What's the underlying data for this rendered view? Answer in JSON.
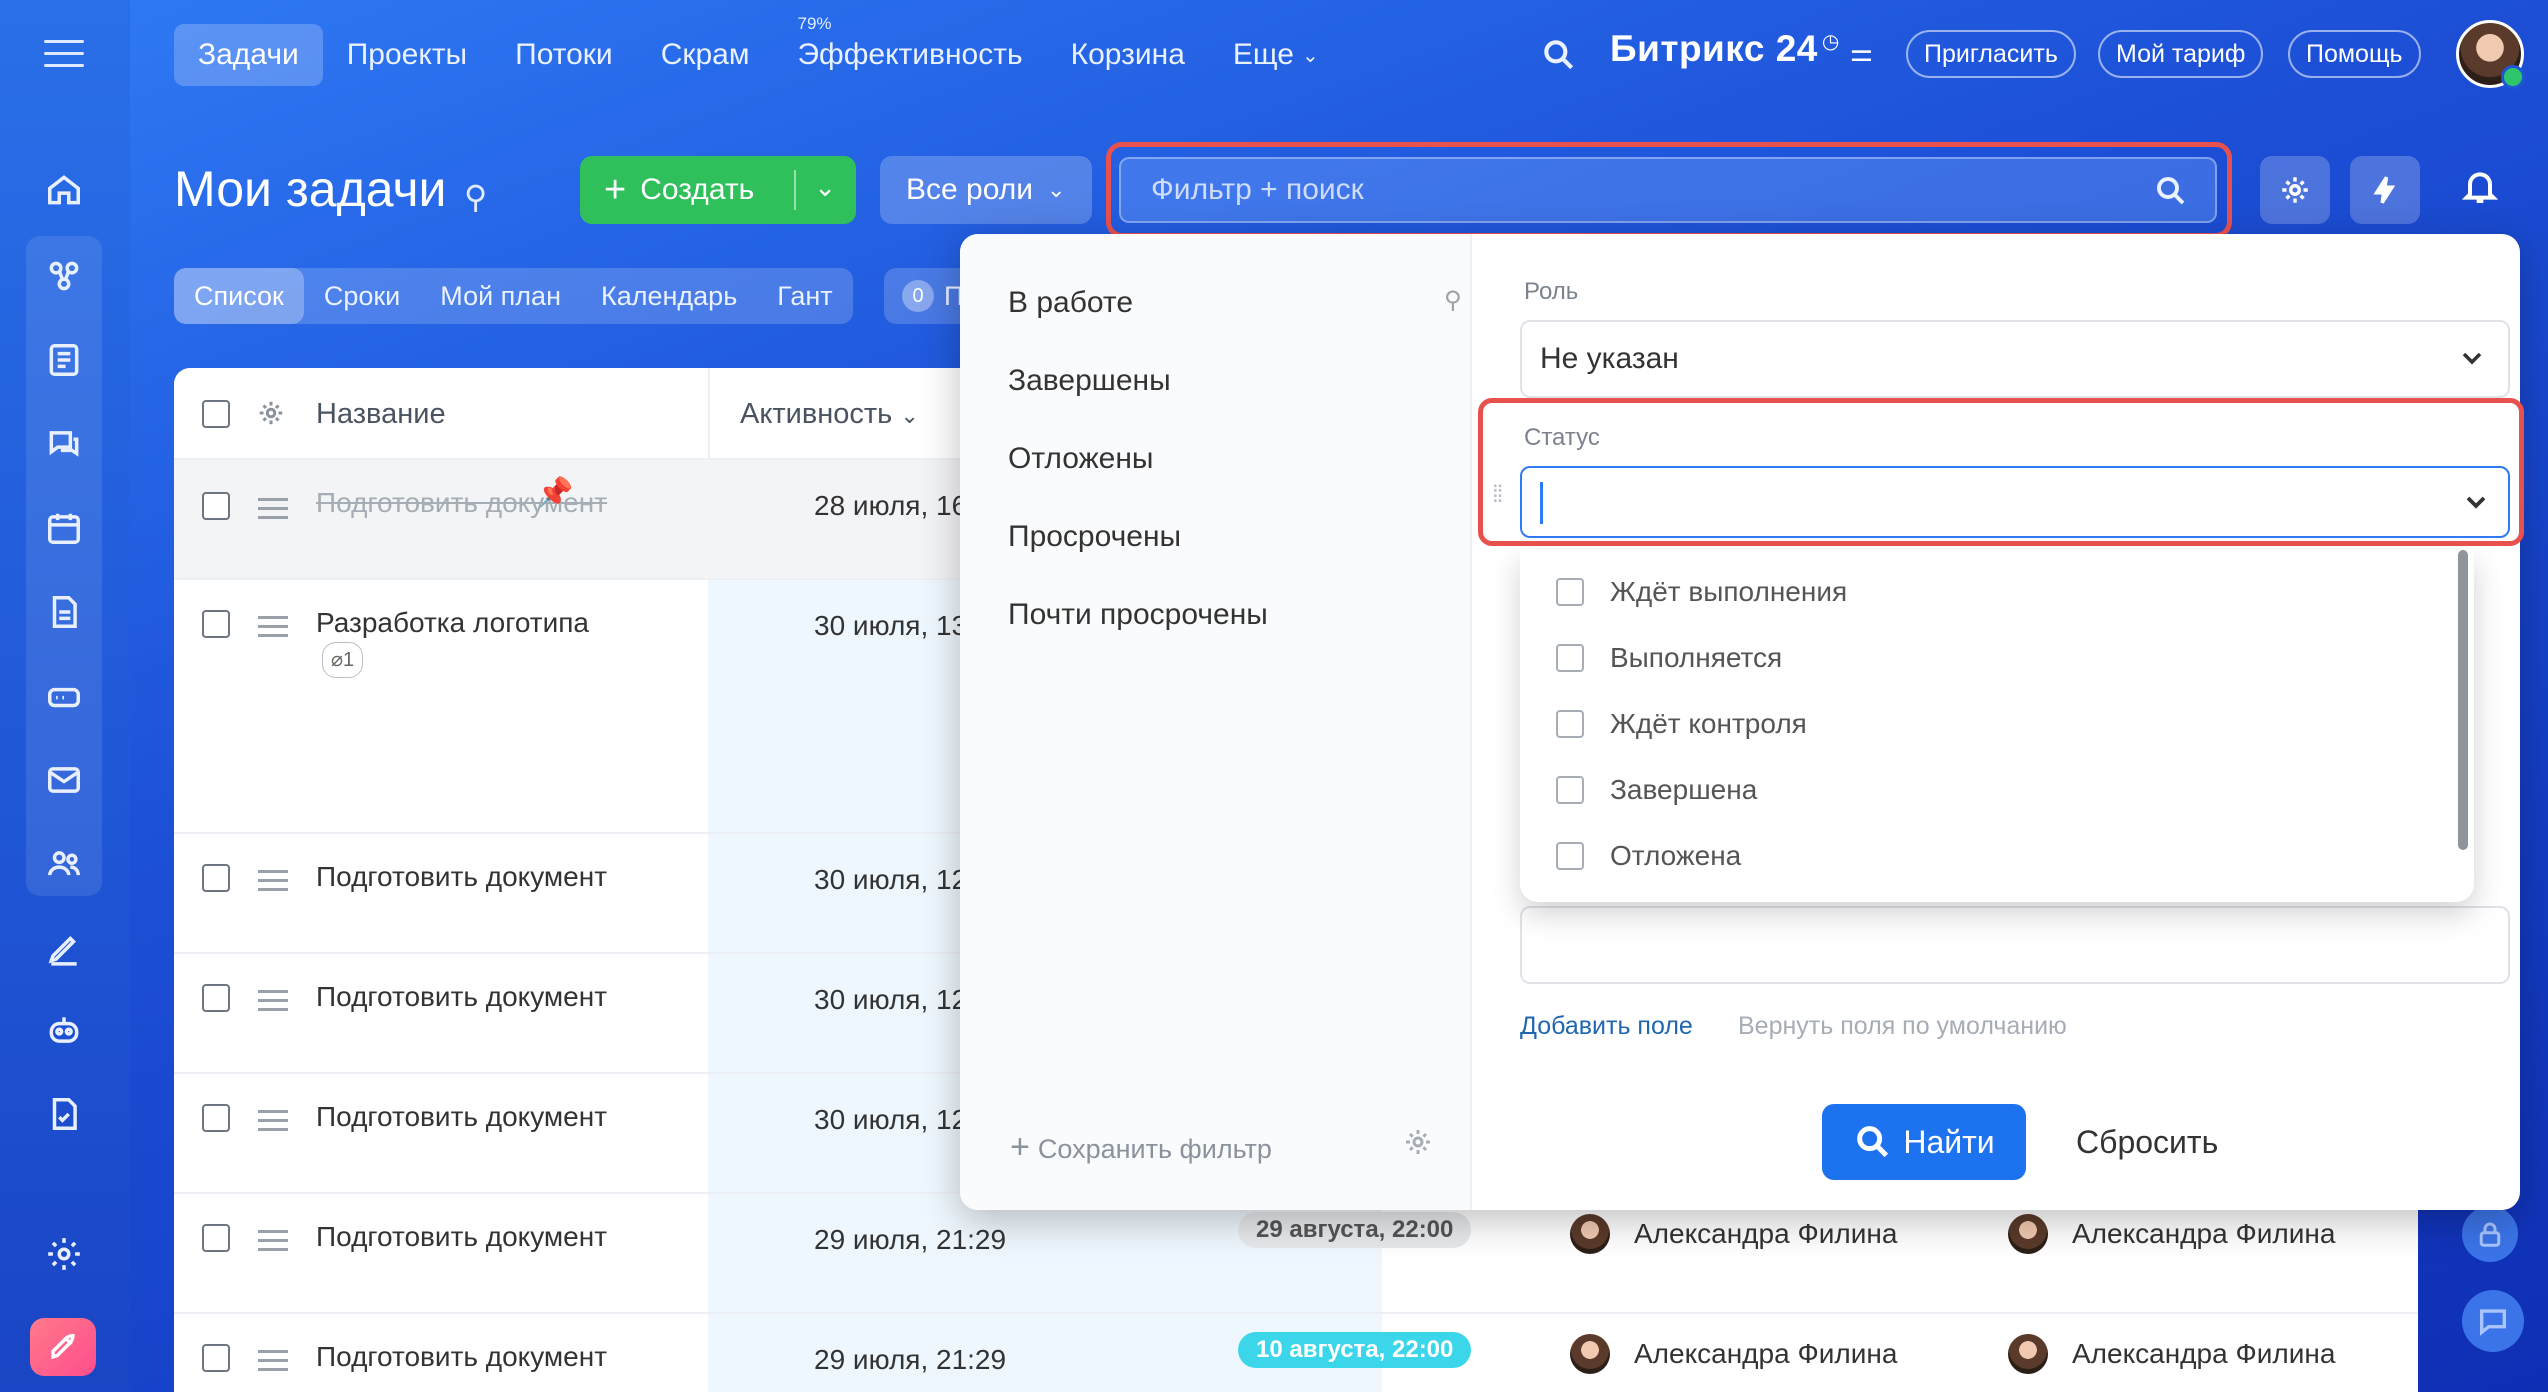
{
  "nav": {
    "items": [
      {
        "label": "Задачи",
        "active": true
      },
      {
        "label": "Проекты"
      },
      {
        "label": "Потоки"
      },
      {
        "label": "Скрам"
      },
      {
        "label": "Эффективность",
        "badge": "79%"
      },
      {
        "label": "Корзина"
      },
      {
        "label": "Еще",
        "dropdown": true
      }
    ]
  },
  "brand": {
    "name": "Битрикс 24"
  },
  "header_buttons": {
    "invite": "Пригласить",
    "tariff": "Мой тариф",
    "help": "Помощь"
  },
  "page": {
    "title": "Мои задачи",
    "create_label": "Создать",
    "roles_label": "Все роли",
    "filter_placeholder": "Фильтр + поиск"
  },
  "view_tabs": [
    "Список",
    "Сроки",
    "Мой план",
    "Календарь",
    "Гант"
  ],
  "counter": {
    "value": "0",
    "text": "П"
  },
  "table": {
    "columns": {
      "name": "Название",
      "activity": "Активность"
    },
    "rows": [
      {
        "title": "Подготовить документ",
        "date": "28 июля, 16",
        "done": true,
        "pinned": true
      },
      {
        "title": "Разработка логотипа",
        "date": "30 июля, 13",
        "attach": "1"
      },
      {
        "title": "Подготовить документ",
        "date": "30 июля, 12"
      },
      {
        "title": "Подготовить документ",
        "date": "30 июля, 12"
      },
      {
        "title": "Подготовить документ",
        "date": "30 июля, 12"
      },
      {
        "title": "Подготовить документ",
        "date": "29 июля, 21:29",
        "deadline": "29 августа, 22:00",
        "deadline_color": "gray",
        "person1": "Александра Филина",
        "person2": "Александра Филина"
      },
      {
        "title": "Подготовить документ",
        "date": "29 июля, 21:29",
        "deadline": "10 августа, 22:00",
        "deadline_color": "cyan",
        "person1": "Александра Филина",
        "person2": "Александра Филина"
      }
    ]
  },
  "filter_popup": {
    "presets": [
      "В работе",
      "Завершены",
      "Отложены",
      "Просрочены",
      "Почти просрочены"
    ],
    "save_filter": "Сохранить фильтр",
    "role_label": "Роль",
    "role_value": "Не указан",
    "status_label": "Статус",
    "status_options": [
      "Ждёт выполнения",
      "Выполняется",
      "Ждёт контроля",
      "Завершена",
      "Отложена"
    ],
    "add_field": "Добавить поле",
    "restore_fields": "Вернуть поля по умолчанию",
    "find": "Найти",
    "reset": "Сбросить"
  },
  "colors": {
    "accent": "#1d72f0",
    "create": "#2fbf5b",
    "highlight": "#e9514f"
  }
}
